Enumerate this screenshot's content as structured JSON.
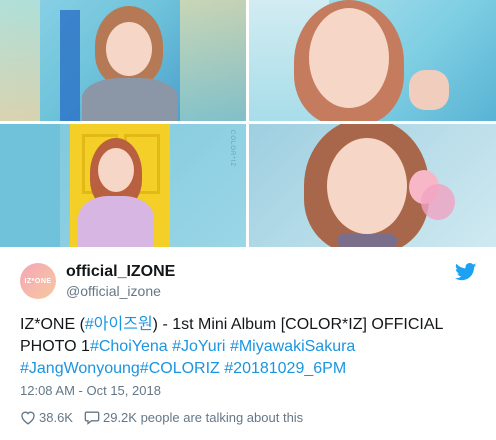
{
  "photos": {
    "logo_text": "COLOR*IZ"
  },
  "tweet": {
    "avatar_text": "IZ*ONE",
    "display_name": "official_IZONE",
    "handle": "@official_izone",
    "text_prefix": "IZ*ONE (",
    "hashtag_1": "#아이즈원",
    "text_middle": ") - 1st Mini Album [COLOR*IZ] OFFICIAL PHOTO 1",
    "hashtag_2": "#ChoiYena",
    "hashtag_3": "#JoYuri",
    "hashtag_4": "#MiyawakiSakura",
    "hashtag_5": "#JangWonyoung",
    "hashtag_6": "#COLORIZ",
    "hashtag_7": "#20181029_6PM",
    "timestamp": "12:08 AM - Oct 15, 2018",
    "likes": "38.6K",
    "replies_text": "29.2K people are talking about this"
  },
  "colors": {
    "link": "#1b95e0",
    "twitter_blue": "#1da1f2",
    "muted": "#657786"
  },
  "icons": {
    "like": "heart-icon",
    "reply": "speech-bubble-icon",
    "brand": "twitter-bird-icon"
  }
}
